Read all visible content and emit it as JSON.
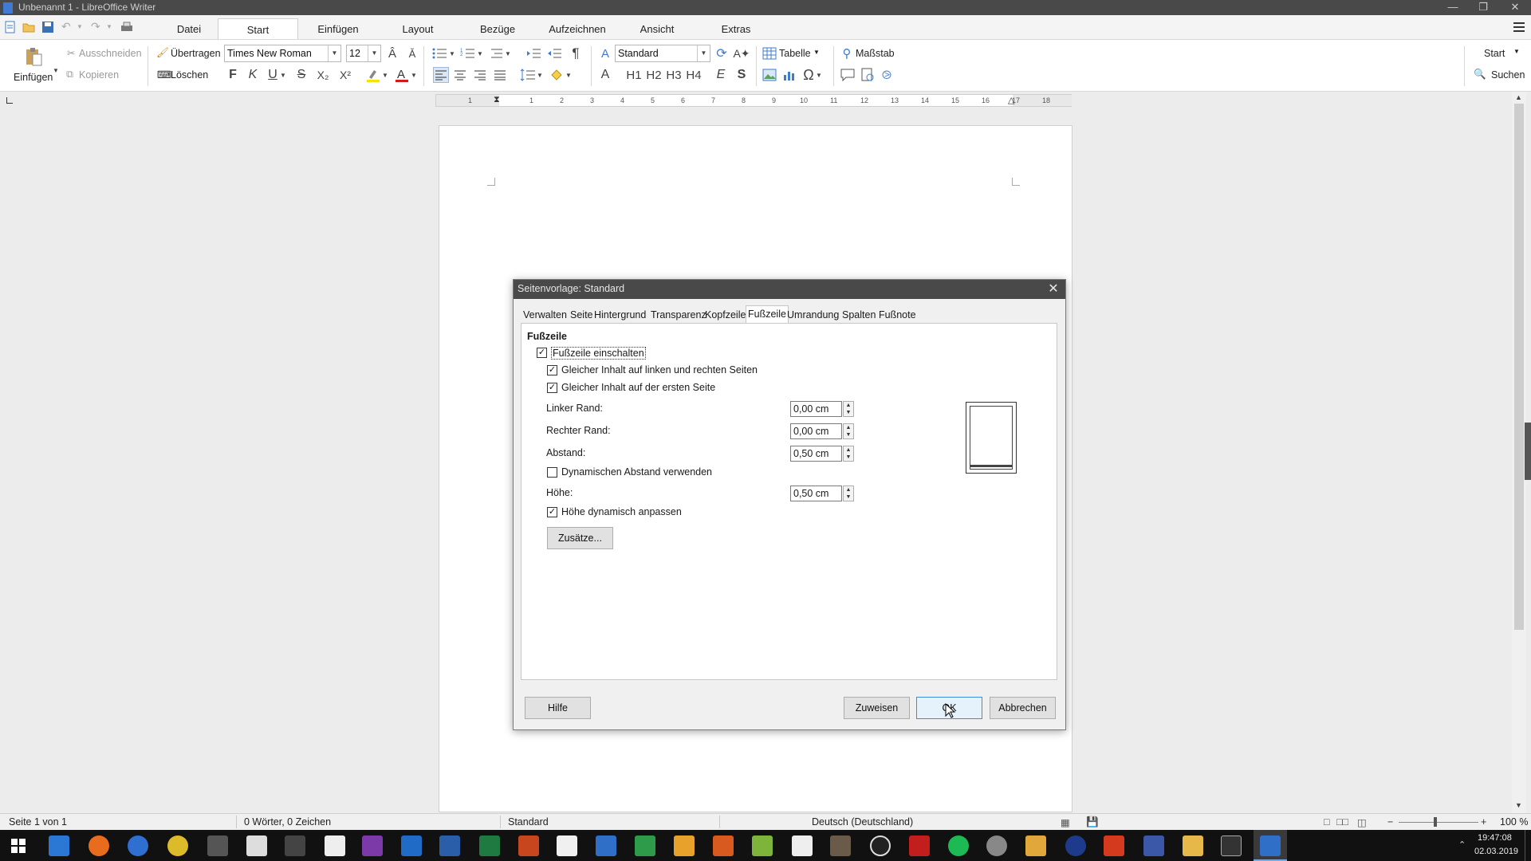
{
  "window": {
    "title": "Unbenannt 1 - LibreOffice Writer"
  },
  "menu": {
    "tabs": [
      "Datei",
      "Start",
      "Einfügen",
      "Layout",
      "Bezüge",
      "Aufzeichnen",
      "Ansicht",
      "Extras"
    ],
    "active": "Start"
  },
  "ribbon": {
    "paste": "Einfügen",
    "cut": "Ausschneiden",
    "copy": "Kopieren",
    "clone": "Übertragen",
    "clear": "Löschen",
    "font_name": "Times New Roman",
    "font_size": "12",
    "paragraph_style": "Standard",
    "table": "Tabelle",
    "zoom": "Maßstab",
    "right_mode": "Start",
    "find": "Suchen",
    "format_letters": {
      "bold": "F",
      "italic": "K",
      "underline": "U",
      "strike": "S",
      "subscript": "X₂",
      "superscript": "X²"
    },
    "headings": [
      "A",
      "H1",
      "H2",
      "H3",
      "H4",
      "E",
      "S"
    ]
  },
  "ruler": {
    "ticks": [
      "1",
      "1",
      "2",
      "3",
      "4",
      "5",
      "6",
      "7",
      "8",
      "9",
      "10",
      "11",
      "12",
      "13",
      "14",
      "15",
      "16",
      "17",
      "18"
    ]
  },
  "statusbar": {
    "page": "Seite 1 von 1",
    "words": "0 Wörter, 0 Zeichen",
    "style": "Standard",
    "language": "Deutsch (Deutschland)",
    "zoom": "100 %"
  },
  "dialog": {
    "title": "Seitenvorlage: Standard",
    "tabs": [
      "Verwalten",
      "Seite",
      "Hintergrund",
      "Transparenz",
      "Kopfzeile",
      "Fußzeile",
      "Umrandung",
      "Spalten",
      "Fußnote"
    ],
    "active_tab": "Fußzeile",
    "section": "Fußzeile",
    "footer_on": {
      "label": "Fußzeile einschalten",
      "checked": true
    },
    "same_left_right": {
      "label": "Gleicher Inhalt auf linken und rechten Seiten",
      "checked": true
    },
    "same_first": {
      "label": "Gleicher Inhalt auf der ersten Seite",
      "checked": true
    },
    "left_margin": {
      "label": "Linker Rand:",
      "value": "0,00 cm"
    },
    "right_margin": {
      "label": "Rechter Rand:",
      "value": "0,00 cm"
    },
    "spacing": {
      "label": "Abstand:",
      "value": "0,50 cm"
    },
    "dynamic_spacing": {
      "label": "Dynamischen Abstand verwenden",
      "checked": false
    },
    "height": {
      "label": "Höhe:",
      "value": "0,50 cm"
    },
    "autofit": {
      "label": "Höhe dynamisch anpassen",
      "checked": true
    },
    "more_button": "Zusätze...",
    "buttons": {
      "help": "Hilfe",
      "reset": "Zuweisen",
      "ok": "OK",
      "cancel": "Abbrechen"
    }
  },
  "taskbar": {
    "time": "19:47:08",
    "date": "02.03.2019"
  }
}
